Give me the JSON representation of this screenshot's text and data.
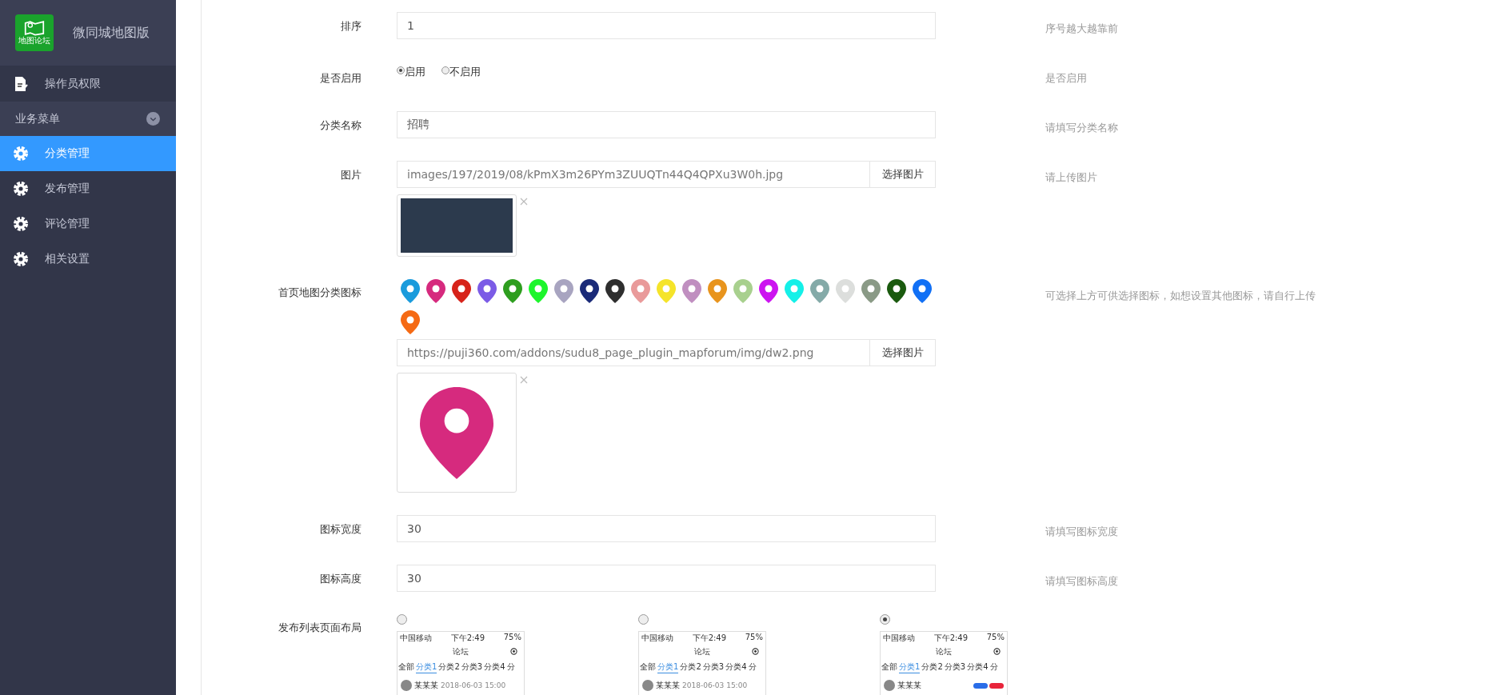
{
  "sidebar": {
    "app_name": "微同城地图版",
    "logo_text": "地图论坛",
    "items": [
      {
        "kind": "link",
        "label": "操作员权限",
        "selected": false
      },
      {
        "kind": "group",
        "label": "业务菜单",
        "expanded": true
      },
      {
        "kind": "link",
        "label": "分类管理",
        "selected": true
      },
      {
        "kind": "link",
        "label": "发布管理",
        "selected": false
      },
      {
        "kind": "link",
        "label": "评论管理",
        "selected": false
      },
      {
        "kind": "link",
        "label": "相关设置",
        "selected": false
      }
    ]
  },
  "form": {
    "rows": [
      {
        "kind": "input",
        "label": "排序",
        "value": "1",
        "hint": "序号越大越靠前"
      },
      {
        "kind": "radio",
        "label": "是否启用",
        "options": [
          {
            "label": "启用",
            "selected": true
          },
          {
            "label": "不启用",
            "selected": false
          }
        ],
        "hint": "是否启用"
      },
      {
        "kind": "input",
        "label": "分类名称",
        "value": "招聘",
        "hint": "请填写分类名称"
      },
      {
        "kind": "image",
        "label": "图片",
        "value": "images/197/2019/08/kPmX3m26PYm3ZUUQTn44Q4QPXu3W0h.jpg",
        "button": "选择图片",
        "hint": "请上传图片"
      },
      {
        "kind": "icons",
        "label": "首页地图分类图标",
        "icons": [
          {
            "color": "#1a9bdc"
          },
          {
            "color": "#d62a7e"
          },
          {
            "color": "#d7231a"
          },
          {
            "color": "#7b5be6"
          },
          {
            "color": "#2e9e1f"
          },
          {
            "color": "#1df52c"
          },
          {
            "color": "#a8a4c0"
          },
          {
            "color": "#1a2a78"
          },
          {
            "color": "#2e2e2e"
          },
          {
            "color": "#e99a9a"
          },
          {
            "color": "#f5e42a"
          },
          {
            "color": "#c08fc0"
          },
          {
            "color": "#e8941d"
          },
          {
            "color": "#a8d08e"
          },
          {
            "color": "#cc14f0"
          },
          {
            "color": "#14f0e8"
          },
          {
            "color": "#84aaa8"
          },
          {
            "color": "#dcdedc"
          },
          {
            "color": "#8a9a86"
          },
          {
            "color": "#1a5a0e"
          },
          {
            "color": "#1170f5"
          },
          {
            "color": "#f56a14"
          }
        ],
        "value": "https://puji360.com/addons/sudu8_page_plugin_mapforum/img/dw2.png",
        "button": "选择图片",
        "hint": "可选择上方可供选择图标，如想设置其他图标，请自行上传"
      },
      {
        "kind": "input",
        "label": "图标宽度",
        "value": "30",
        "hint": "请填写图标宽度"
      },
      {
        "kind": "input",
        "label": "图标高度",
        "value": "30",
        "hint": "请填写图标高度"
      },
      {
        "kind": "layout",
        "label": "发布列表页面布局",
        "options": [
          {
            "selected": false,
            "carrier": "中国移动",
            "time": "下午2:49",
            "battery": "75%",
            "title": "论坛",
            "tabs": [
              "全部",
              "分类1",
              "分类2",
              "分类3",
              "分类4",
              "分"
            ],
            "user": "某某某",
            "date": "2018-06-03 15:00",
            "badges": false
          },
          {
            "selected": false,
            "carrier": "中国移动",
            "time": "下午2:49",
            "battery": "75%",
            "title": "论坛",
            "tabs": [
              "全部",
              "分类1",
              "分类2",
              "分类3",
              "分类4",
              "分"
            ],
            "user": "某某某",
            "date": "2018-06-03 15:00",
            "badges": false
          },
          {
            "selected": true,
            "carrier": "中国移动",
            "time": "下午2:49",
            "battery": "75%",
            "title": "论坛",
            "tabs": [
              "全部",
              "分类1",
              "分类2",
              "分类3",
              "分类4",
              "分"
            ],
            "user": "某某某",
            "badges": true
          }
        ]
      }
    ]
  }
}
